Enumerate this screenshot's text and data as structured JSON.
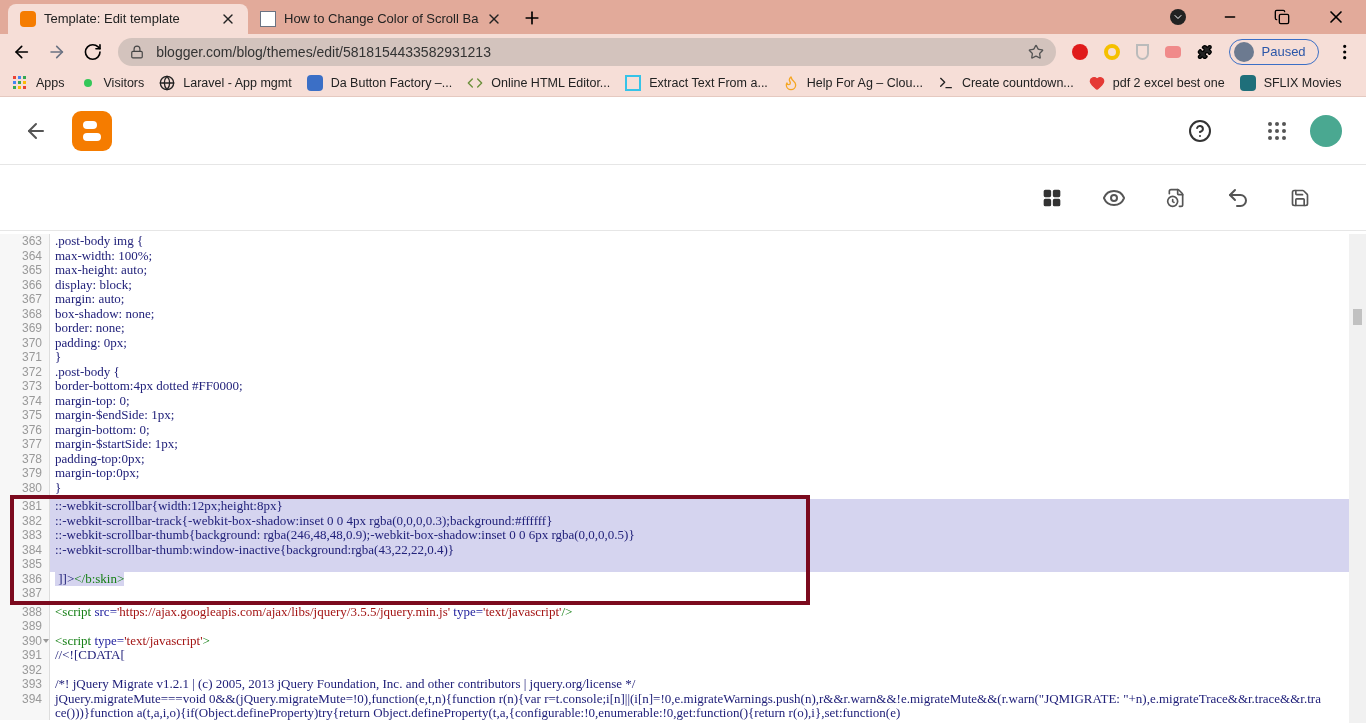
{
  "browser": {
    "tabs": [
      {
        "title": "Template: Edit template",
        "selected": true,
        "kind": "blogger"
      },
      {
        "title": "How to Change Color of Scroll Ba",
        "selected": false,
        "kind": "site"
      }
    ],
    "address": "blogger.com/blog/themes/edit/5818154433582931213",
    "profile": "Paused",
    "bookmarks": [
      {
        "label": "Apps",
        "kind": "apps"
      },
      {
        "label": "Visitors",
        "kind": "dot"
      },
      {
        "label": "Laravel - App mgmt",
        "kind": "globe"
      },
      {
        "label": "Da Button Factory –...",
        "kind": "b"
      },
      {
        "label": "Online HTML Editor...",
        "kind": "code"
      },
      {
        "label": "Extract Text From a...",
        "kind": "b2"
      },
      {
        "label": "Help For Ag – Clou...",
        "kind": "fire"
      },
      {
        "label": "Create countdown...",
        "kind": "term"
      },
      {
        "label": "pdf 2 excel best one",
        "kind": "heart"
      },
      {
        "label": "SFLIX Movies",
        "kind": "s"
      }
    ]
  },
  "editor": {
    "lines": [
      {
        "num": "363",
        "selected": false,
        "fold": false,
        "segments": [
          {
            "kind": "text",
            "text": ".post-body img {"
          }
        ]
      },
      {
        "num": "364",
        "selected": false,
        "fold": false,
        "segments": [
          {
            "kind": "text",
            "text": "max-width: 100%;"
          }
        ]
      },
      {
        "num": "365",
        "selected": false,
        "fold": false,
        "segments": [
          {
            "kind": "text",
            "text": "max-height: auto;"
          }
        ]
      },
      {
        "num": "366",
        "selected": false,
        "fold": false,
        "segments": [
          {
            "kind": "text",
            "text": "display: block;"
          }
        ]
      },
      {
        "num": "367",
        "selected": false,
        "fold": false,
        "segments": [
          {
            "kind": "text",
            "text": "margin: auto;"
          }
        ]
      },
      {
        "num": "368",
        "selected": false,
        "fold": false,
        "segments": [
          {
            "kind": "text",
            "text": "box-shadow: none;"
          }
        ]
      },
      {
        "num": "369",
        "selected": false,
        "fold": false,
        "segments": [
          {
            "kind": "text",
            "text": "border: none;"
          }
        ]
      },
      {
        "num": "370",
        "selected": false,
        "fold": false,
        "segments": [
          {
            "kind": "text",
            "text": "padding: 0px;"
          }
        ]
      },
      {
        "num": "371",
        "selected": false,
        "fold": false,
        "segments": [
          {
            "kind": "text",
            "text": "}"
          }
        ]
      },
      {
        "num": "372",
        "selected": false,
        "fold": false,
        "segments": [
          {
            "kind": "text",
            "text": ".post-body {"
          }
        ]
      },
      {
        "num": "373",
        "selected": false,
        "fold": false,
        "segments": [
          {
            "kind": "text",
            "text": "border-bottom:4px dotted #FF0000;"
          }
        ]
      },
      {
        "num": "374",
        "selected": false,
        "fold": false,
        "segments": [
          {
            "kind": "text",
            "text": "margin-top: 0;"
          }
        ]
      },
      {
        "num": "375",
        "selected": false,
        "fold": false,
        "segments": [
          {
            "kind": "text",
            "text": "margin-$endSide: 1px;"
          }
        ]
      },
      {
        "num": "376",
        "selected": false,
        "fold": false,
        "segments": [
          {
            "kind": "text",
            "text": "margin-bottom: 0;"
          }
        ]
      },
      {
        "num": "377",
        "selected": false,
        "fold": false,
        "segments": [
          {
            "kind": "text",
            "text": "margin-$startSide: 1px;"
          }
        ]
      },
      {
        "num": "378",
        "selected": false,
        "fold": false,
        "segments": [
          {
            "kind": "text",
            "text": "padding-top:0px;"
          }
        ]
      },
      {
        "num": "379",
        "selected": false,
        "fold": false,
        "segments": [
          {
            "kind": "text",
            "text": "margin-top:0px;"
          }
        ]
      },
      {
        "num": "380",
        "selected": false,
        "fold": false,
        "segments": [
          {
            "kind": "text",
            "text": "}"
          }
        ]
      },
      {
        "num": "381",
        "selected": true,
        "fold": false,
        "segments": [
          {
            "kind": "text",
            "text": "::-webkit-scrollbar{width:12px;height:8px}"
          }
        ]
      },
      {
        "num": "382",
        "selected": true,
        "fold": false,
        "segments": [
          {
            "kind": "text",
            "text": "::-webkit-scrollbar-track{-webkit-box-shadow:inset 0 0 4px rgba(0,0,0,0.3);background:#ffffff}"
          }
        ]
      },
      {
        "num": "383",
        "selected": true,
        "fold": false,
        "segments": [
          {
            "kind": "text",
            "text": "::-webkit-scrollbar-thumb{background: rgba(246,48,48,0.9);-webkit-box-shadow:inset 0 0 6px rgba(0,0,0,0.5)}"
          }
        ]
      },
      {
        "num": "384",
        "selected": true,
        "fold": false,
        "segments": [
          {
            "kind": "text",
            "text": "::-webkit-scrollbar-thumb:window-inactive{background:rgba(43,22,22,0.4)}"
          }
        ]
      },
      {
        "num": "385",
        "selected": true,
        "fold": false
      },
      {
        "num": "386",
        "selected": true,
        "fold": false,
        "segments": [
          {
            "kind": "text",
            "text": " ]]>"
          },
          {
            "kind": "tag",
            "text": "</b:skin>"
          }
        ]
      },
      {
        "num": "387",
        "selected": false,
        "fold": false
      },
      {
        "num": "388",
        "selected": false,
        "fold": false,
        "segments": [
          {
            "kind": "tag",
            "text": "<script "
          },
          {
            "kind": "attr",
            "text": "src="
          },
          {
            "kind": "string",
            "text": "'https://ajax.googleapis.com/ajax/libs/jquery/3.5.5/jquery.min.js'"
          },
          {
            "kind": "attr",
            "text": " type="
          },
          {
            "kind": "string",
            "text": "'text/javascript'"
          },
          {
            "kind": "tag",
            "text": "/>"
          }
        ]
      },
      {
        "num": "389",
        "selected": false,
        "fold": false
      },
      {
        "num": "390",
        "selected": false,
        "fold": true,
        "segments": [
          {
            "kind": "tag",
            "text": "<script "
          },
          {
            "kind": "attr",
            "text": "type="
          },
          {
            "kind": "string",
            "text": "'text/javascript'"
          },
          {
            "kind": "tag",
            "text": ">"
          }
        ]
      },
      {
        "num": "391",
        "selected": false,
        "fold": false,
        "segments": [
          {
            "kind": "text",
            "text": "//<![CDATA["
          }
        ]
      },
      {
        "num": "392",
        "selected": false,
        "fold": false
      },
      {
        "num": "393",
        "selected": false,
        "fold": false,
        "segments": [
          {
            "kind": "text",
            "text": "/*! jQuery Migrate v1.2.1 | (c) 2005, 2013 jQuery Foundation, Inc. and other contributors | jquery.org/license */"
          }
        ]
      },
      {
        "num": "394",
        "selected": false,
        "fold": false,
        "segments": [
          {
            "kind": "text",
            "text": "jQuery.migrateMute===void 0&&(jQuery.migrateMute=!0),function(e,t,n){function r(n){var r=t.console;i[n]||(i[n]=!0,e.migrateWarnings.push(n),r&&r.warn&&!e.migrateMute&&(r.warn(\"JQMIGRATE: \"+n),e.migrateTrace&&r.trace&&r.trace()))}function a(t,a,i,o){if(Object.defineProperty)try{return Object.defineProperty(t,a,{configurable:!0,enumerable:!0,get:function(){return r(o),i},set:function(e)"
          }
        ]
      }
    ]
  }
}
